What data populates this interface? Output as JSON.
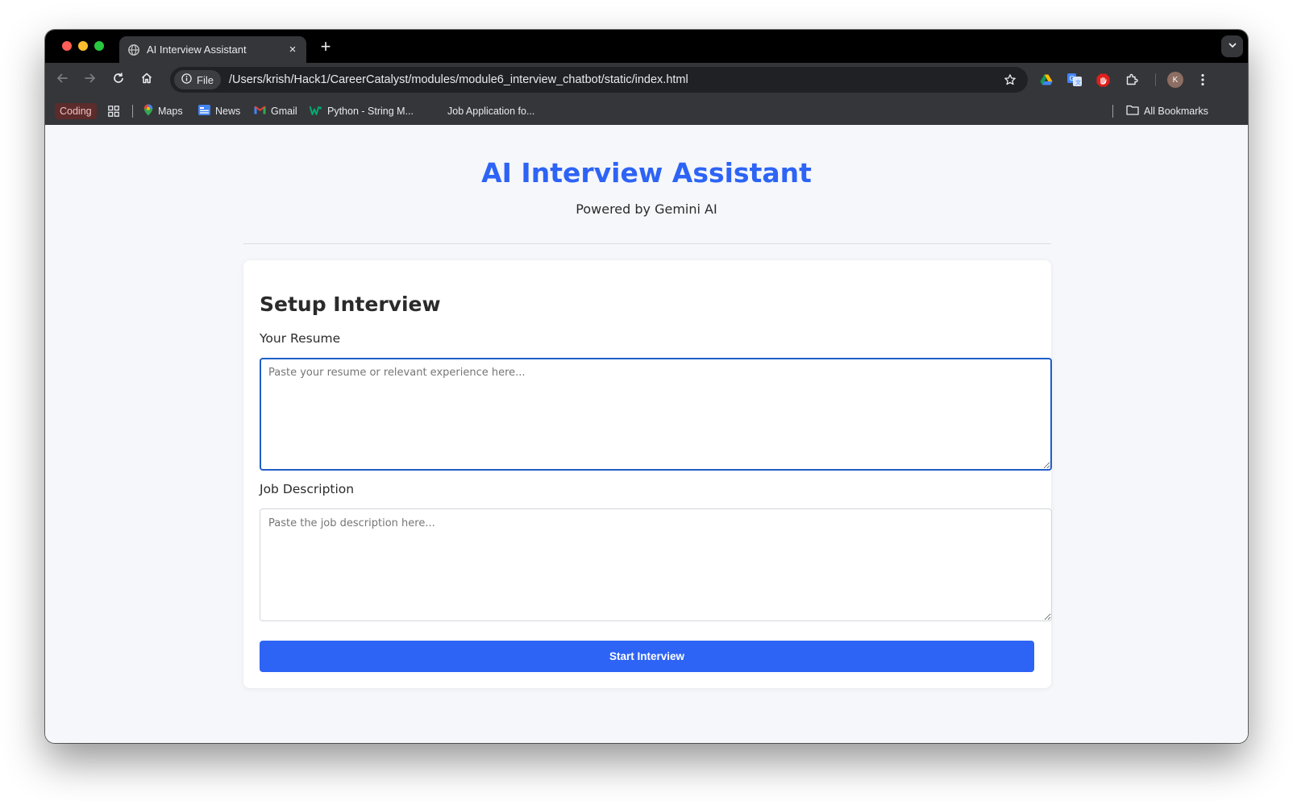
{
  "browser": {
    "tab_title": "AI Interview Assistant",
    "new_tab_symbol": "+",
    "close_symbol": "×",
    "file_chip_label": "File",
    "url": "/Users/krish/Hack1/CareerCatalyst/modules/module6_interview_chatbot/static/index.html",
    "avatar_initial": "K",
    "bookmarks": {
      "coding": "Coding",
      "maps": "Maps",
      "news": "News",
      "gmail": "Gmail",
      "python": "Python - String M...",
      "job": "Job Application fo...",
      "all": "All Bookmarks"
    },
    "icons": [
      "globe-icon",
      "back-arrow-icon",
      "forward-arrow-icon",
      "reload-icon",
      "home-icon",
      "info-icon",
      "star-icon",
      "google-drive-icon",
      "google-translate-icon",
      "adblock-icon",
      "extensions-icon",
      "kebab-menu-icon",
      "apps-grid-icon",
      "folder-icon",
      "chevron-down-icon"
    ]
  },
  "page": {
    "title": "AI Interview Assistant",
    "subtitle": "Powered by Gemini AI",
    "card": {
      "heading": "Setup Interview",
      "resume_label": "Your Resume",
      "resume_placeholder": "Paste your resume or relevant experience here...",
      "resume_value": "",
      "job_label": "Job Description",
      "job_placeholder": "Paste the job description here...",
      "job_value": "",
      "start_button": "Start Interview"
    }
  },
  "colors": {
    "accent": "#2d64f5",
    "focus_border": "#1f5fc9",
    "page_bg": "#f6f7fb",
    "chrome_dark": "#35363a"
  }
}
